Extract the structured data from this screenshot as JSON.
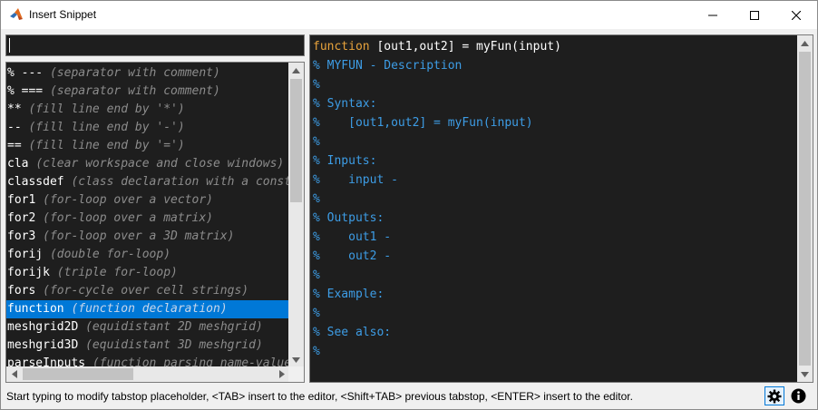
{
  "window": {
    "title": "Insert Snippet"
  },
  "search": {
    "value": "",
    "placeholder": ""
  },
  "snippets": [
    {
      "key": "% ---",
      "desc": "(separator with comment)"
    },
    {
      "key": "% ===",
      "desc": "(separator with comment)"
    },
    {
      "key": "**",
      "desc": "(fill line end by '*')"
    },
    {
      "key": "--",
      "desc": "(fill line end by '-')"
    },
    {
      "key": "==",
      "desc": "(fill line end by '=')"
    },
    {
      "key": "cla",
      "desc": "(clear workspace and close windows)"
    },
    {
      "key": "classdef",
      "desc": "(class declaration with a constructor)"
    },
    {
      "key": "for1",
      "desc": "(for-loop over a vector)"
    },
    {
      "key": "for2",
      "desc": "(for-loop over a matrix)"
    },
    {
      "key": "for3",
      "desc": "(for-loop over a 3D matrix)"
    },
    {
      "key": "forij",
      "desc": "(double for-loop)"
    },
    {
      "key": "forijk",
      "desc": "(triple for-loop)"
    },
    {
      "key": "fors",
      "desc": "(for-cycle over cell strings)"
    },
    {
      "key": "function",
      "desc": "(function declaration)",
      "selected": true
    },
    {
      "key": "meshgrid2D",
      "desc": "(equidistant 2D meshgrid)"
    },
    {
      "key": "meshgrid3D",
      "desc": "(equidistant 3D meshgrid)"
    },
    {
      "key": "parseInputs",
      "desc": "(function parsing name-value pairs)"
    }
  ],
  "preview": {
    "lines": [
      {
        "parts": [
          {
            "cls": "kw",
            "text": "function"
          },
          {
            "cls": "plain",
            "text": " [out1,out2] = myFun(input)"
          }
        ]
      },
      {
        "parts": [
          {
            "cls": "cmt",
            "text": "% MYFUN - Description"
          }
        ]
      },
      {
        "parts": [
          {
            "cls": "cmt",
            "text": "%"
          }
        ]
      },
      {
        "parts": [
          {
            "cls": "cmt",
            "text": "% Syntax:"
          }
        ]
      },
      {
        "parts": [
          {
            "cls": "cmt",
            "text": "%    [out1,out2] = myFun(input)"
          }
        ]
      },
      {
        "parts": [
          {
            "cls": "cmt",
            "text": "%"
          }
        ]
      },
      {
        "parts": [
          {
            "cls": "cmt",
            "text": "% Inputs:"
          }
        ]
      },
      {
        "parts": [
          {
            "cls": "cmt",
            "text": "%    input -"
          }
        ]
      },
      {
        "parts": [
          {
            "cls": "cmt",
            "text": "%"
          }
        ]
      },
      {
        "parts": [
          {
            "cls": "cmt",
            "text": "% Outputs:"
          }
        ]
      },
      {
        "parts": [
          {
            "cls": "cmt",
            "text": "%    out1 -"
          }
        ]
      },
      {
        "parts": [
          {
            "cls": "cmt",
            "text": "%    out2 -"
          }
        ]
      },
      {
        "parts": [
          {
            "cls": "cmt",
            "text": "%"
          }
        ]
      },
      {
        "parts": [
          {
            "cls": "cmt",
            "text": "% Example:"
          }
        ]
      },
      {
        "parts": [
          {
            "cls": "cmt",
            "text": "%"
          }
        ]
      },
      {
        "parts": [
          {
            "cls": "cmt",
            "text": "% See also:"
          }
        ]
      },
      {
        "parts": [
          {
            "cls": "cmt",
            "text": "%"
          }
        ]
      }
    ]
  },
  "status": {
    "text": "Start typing to modify tabstop placeholder, <TAB> insert to the editor, <Shift+TAB> previous tabstop, <ENTER> insert to the editor."
  },
  "icons": {
    "app": "matlab-icon",
    "minimize": "minimize-icon",
    "maximize": "maximize-icon",
    "close": "close-icon",
    "settings": "gear-icon",
    "info": "info-icon"
  },
  "colors": {
    "selection": "#0078d7",
    "keyword": "#e8a33c",
    "comment": "#3d9de6",
    "background": "#1e1e1e"
  }
}
